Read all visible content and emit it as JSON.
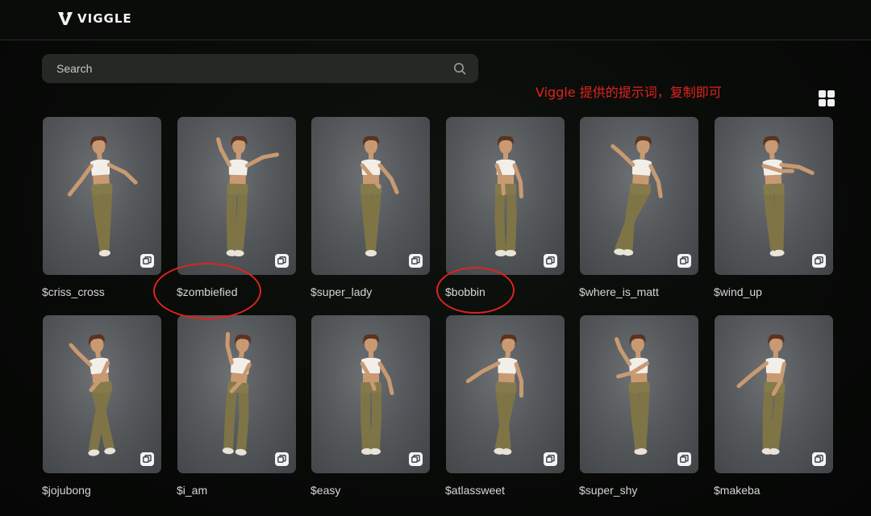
{
  "header": {
    "logo_text": "VIGGLE"
  },
  "search": {
    "placeholder": "Search"
  },
  "annotation": {
    "text": "Viggle 提供的提示词，复制即可",
    "color": "#e0231d"
  },
  "view_toggle": {
    "icon": "grid-view-icon"
  },
  "templates": [
    {
      "label": "$criss_cross"
    },
    {
      "label": "$zombiefied"
    },
    {
      "label": "$super_lady"
    },
    {
      "label": "$bobbin"
    },
    {
      "label": "$where_is_matt"
    },
    {
      "label": "$wind_up"
    },
    {
      "label": "$jojubong"
    },
    {
      "label": "$i_am"
    },
    {
      "label": "$easy"
    },
    {
      "label": "$atlassweet"
    },
    {
      "label": "$super_shy"
    },
    {
      "label": "$makeba"
    }
  ],
  "copy_icon": "copy-icon",
  "highlighted": [
    "$zombiefied",
    "$bobbin"
  ]
}
